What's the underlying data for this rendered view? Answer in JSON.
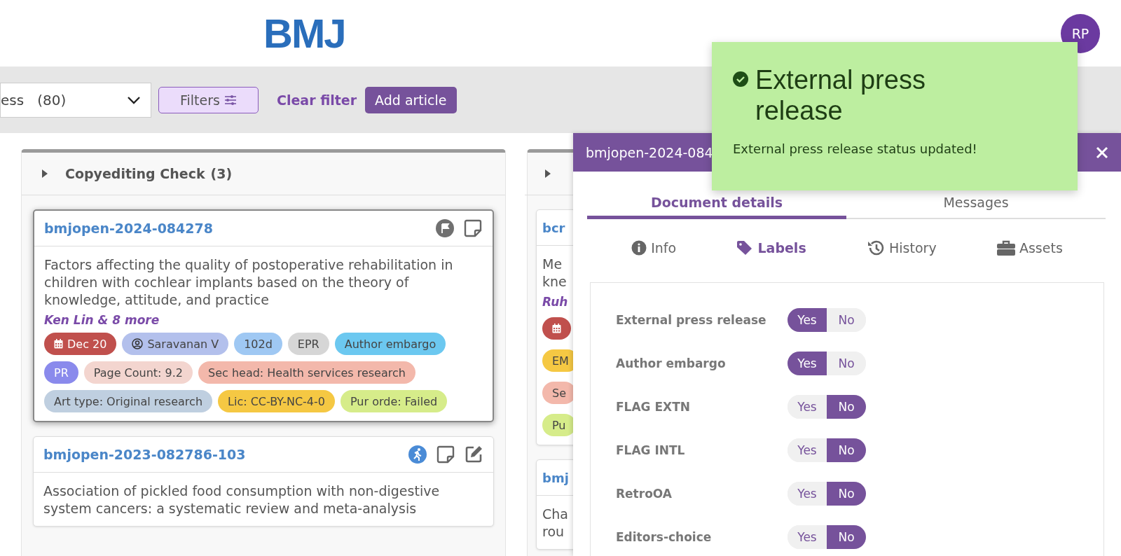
{
  "header": {
    "logo": "BMJ",
    "avatar": "RP"
  },
  "toolbar": {
    "status_select": "ess   (80)",
    "filters_button": "Filters",
    "clear_filter": "Clear filter",
    "add_article": "Add article"
  },
  "columns": [
    {
      "title": "Copyediting Check",
      "count": "(3)",
      "expanded": false,
      "cards": [
        {
          "id": "bmjopen-2024-084278",
          "selected": true,
          "icons": [
            {
              "kind": "flag"
            },
            {
              "kind": "note"
            }
          ],
          "title": "Factors affecting the quality of postoperative rehabilitation in children with cochlear implants based on the theory of knowledge, attitude, and practice",
          "authors": "Ken Lin & 8 more",
          "tags": [
            {
              "kind": "date",
              "text": "Dec 20",
              "color": "#c0504d"
            },
            {
              "kind": "assignee",
              "text": "Saravanan V",
              "color": "#b3c0ec"
            },
            {
              "kind": "plain",
              "text": "102d",
              "color": "#9fc8f3"
            },
            {
              "kind": "plain",
              "text": "EPR",
              "color": "#d6d6d6"
            },
            {
              "kind": "plain",
              "text": "Author embargo",
              "color": "#6cc8f0"
            },
            {
              "kind": "initials",
              "text": "PR",
              "color": "#8a8aec"
            },
            {
              "kind": "plain",
              "text": "Page Count: 9.2",
              "color": "#f3d5cf"
            },
            {
              "kind": "plain",
              "text": "Sec head: Health services research",
              "color": "#f3b8ab"
            },
            {
              "kind": "plain",
              "text": "Art type: Original research",
              "color": "#bfcfe0"
            },
            {
              "kind": "plain",
              "text": "Lic: CC-BY-NC-4-0",
              "color": "#f5c843"
            },
            {
              "kind": "plain",
              "text": "Pur orde: Failed",
              "color": "#d6ec8a"
            }
          ]
        },
        {
          "id": "bmjopen-2023-082786-103",
          "selected": false,
          "icons": [
            {
              "kind": "runner"
            },
            {
              "kind": "note"
            },
            {
              "kind": "edit"
            }
          ],
          "title": "Association of pickled food consumption with non-digestive system cancers: a systematic review and meta-analysis"
        }
      ]
    },
    {
      "expanded": false,
      "cards": [
        {
          "id": "bcr",
          "selected": false,
          "title_lines": [
            "Me",
            "kne"
          ],
          "authors": "Ruh",
          "tags": [
            {
              "kind": "date",
              "color": "#c0504d"
            },
            {
              "kind": "plain",
              "text": "EM",
              "color": "#f5c843"
            },
            {
              "kind": "plain",
              "text": "Se",
              "color": "#f3b8ab"
            },
            {
              "kind": "plain",
              "text": "Pu",
              "color": "#d6ec8a"
            }
          ]
        },
        {
          "id": "bmj",
          "selected": false,
          "title_lines": [
            "Cha",
            "rou"
          ]
        }
      ]
    }
  ],
  "drawer": {
    "title": "bmjopen-2024-084",
    "tabs": [
      {
        "label": "Document details",
        "selected": true
      },
      {
        "label": "Messages",
        "selected": false
      }
    ],
    "subtabs": [
      {
        "kind": "info",
        "label": "Info",
        "selected": false
      },
      {
        "kind": "labels",
        "label": "Labels",
        "selected": true
      },
      {
        "kind": "history",
        "label": "History",
        "selected": false
      },
      {
        "kind": "assets",
        "label": "Assets",
        "selected": false
      }
    ],
    "labels": [
      {
        "name": "External press release",
        "options": [
          {
            "label": "Yes",
            "selected": true
          },
          {
            "label": "No",
            "selected": false
          }
        ]
      },
      {
        "name": "Author embargo",
        "options": [
          {
            "label": "Yes",
            "selected": true
          },
          {
            "label": "No",
            "selected": false
          }
        ]
      },
      {
        "name": "FLAG EXTN",
        "options": [
          {
            "label": "Yes",
            "selected": false
          },
          {
            "label": "No",
            "selected": true
          }
        ]
      },
      {
        "name": "FLAG INTL",
        "options": [
          {
            "label": "Yes",
            "selected": false
          },
          {
            "label": "No",
            "selected": true
          }
        ]
      },
      {
        "name": "RetroOA",
        "options": [
          {
            "label": "Yes",
            "selected": false
          },
          {
            "label": "No",
            "selected": true
          }
        ]
      },
      {
        "name": "Editors-choice",
        "options": [
          {
            "label": "Yes",
            "selected": false
          },
          {
            "label": "No",
            "selected": true
          }
        ]
      }
    ]
  },
  "toast": {
    "title": "External press release",
    "message": "External press release status updated!"
  }
}
